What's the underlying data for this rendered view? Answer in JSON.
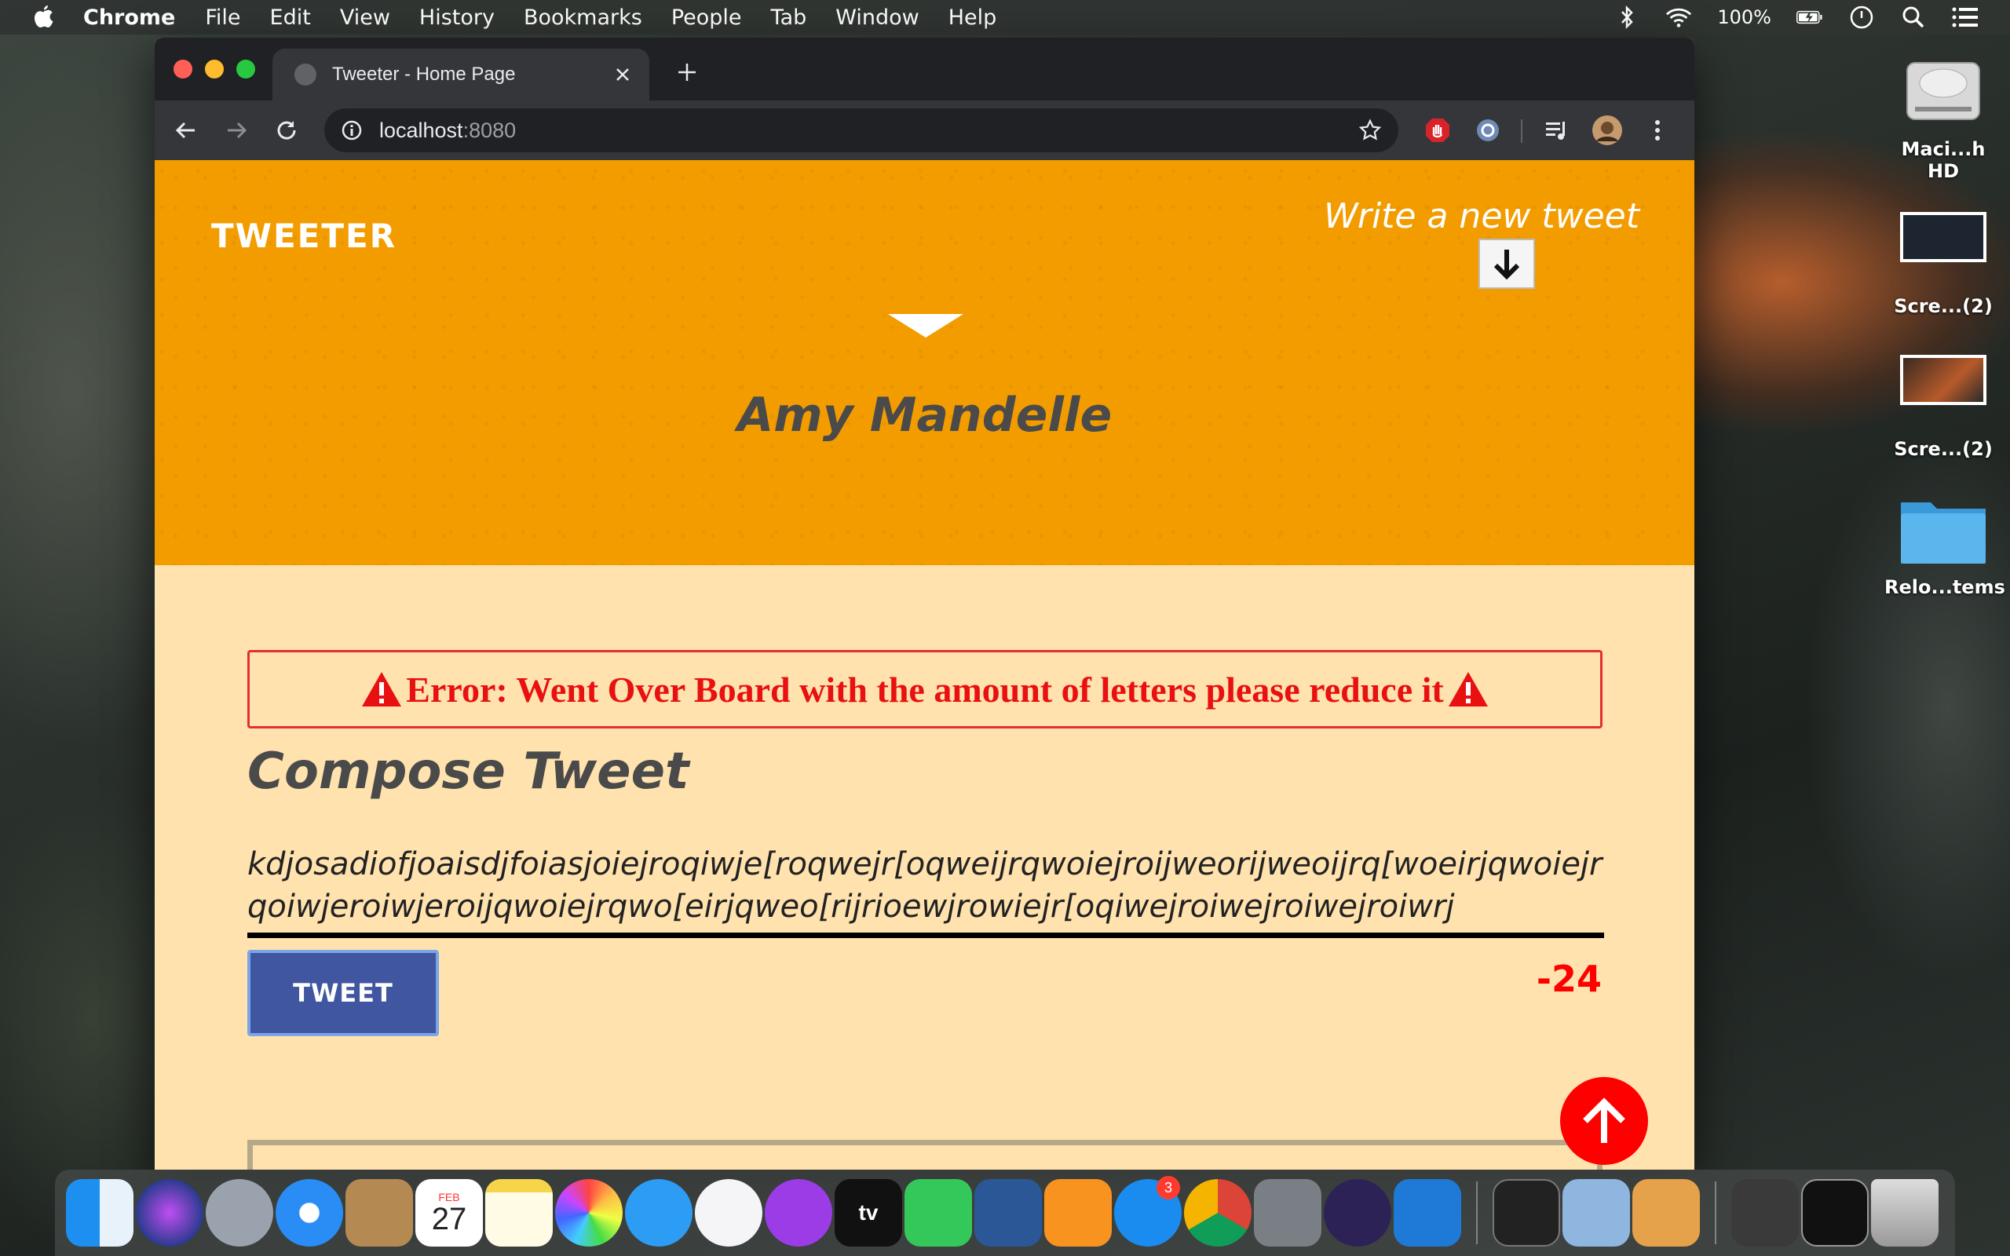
{
  "menubar": {
    "app_name": "Chrome",
    "items": [
      "File",
      "Edit",
      "View",
      "History",
      "Bookmarks",
      "People",
      "Tab",
      "Window",
      "Help"
    ],
    "battery": "100%"
  },
  "browser": {
    "tab_title": "Tweeter - Home Page",
    "url_host": "localhost",
    "url_port": ":8080"
  },
  "page": {
    "brand": "TWEETER",
    "write_new_tweet": "Write a new tweet",
    "profile_name": "Amy Mandelle",
    "error_message": "Error: Went Over Board with the amount of letters please reduce it",
    "compose_title": "Compose Tweet",
    "tweet_text": "kdjosadiofjoaisdjfoiasjoiejroqiwje[roqwejr[oqweijrqwoiejroijweorijweoijrq[woeirjqwoiejrqoiwjeroiwjeroijqwoiejrqwo[eirjqweo[rijrioewjrowiejr[oqiwejroiwejroiwejroiwrj",
    "tweet_button": "TWEET",
    "char_counter": "-24"
  },
  "desktop": {
    "icons": [
      {
        "label": "Maci...h HD"
      },
      {
        "label": "Scre...(2)"
      },
      {
        "label": "Scre...(2)"
      },
      {
        "label": "Relo...tems"
      }
    ]
  },
  "dock": {
    "calendar_month": "FEB",
    "calendar_day": "27",
    "tv_label": "tv",
    "app_store_badge": "3"
  },
  "colors": {
    "hero_bg": "#f39c00",
    "page_bg": "#ffe2ad",
    "error_red": "#e81010",
    "tweet_button_bg": "#4056a1"
  }
}
